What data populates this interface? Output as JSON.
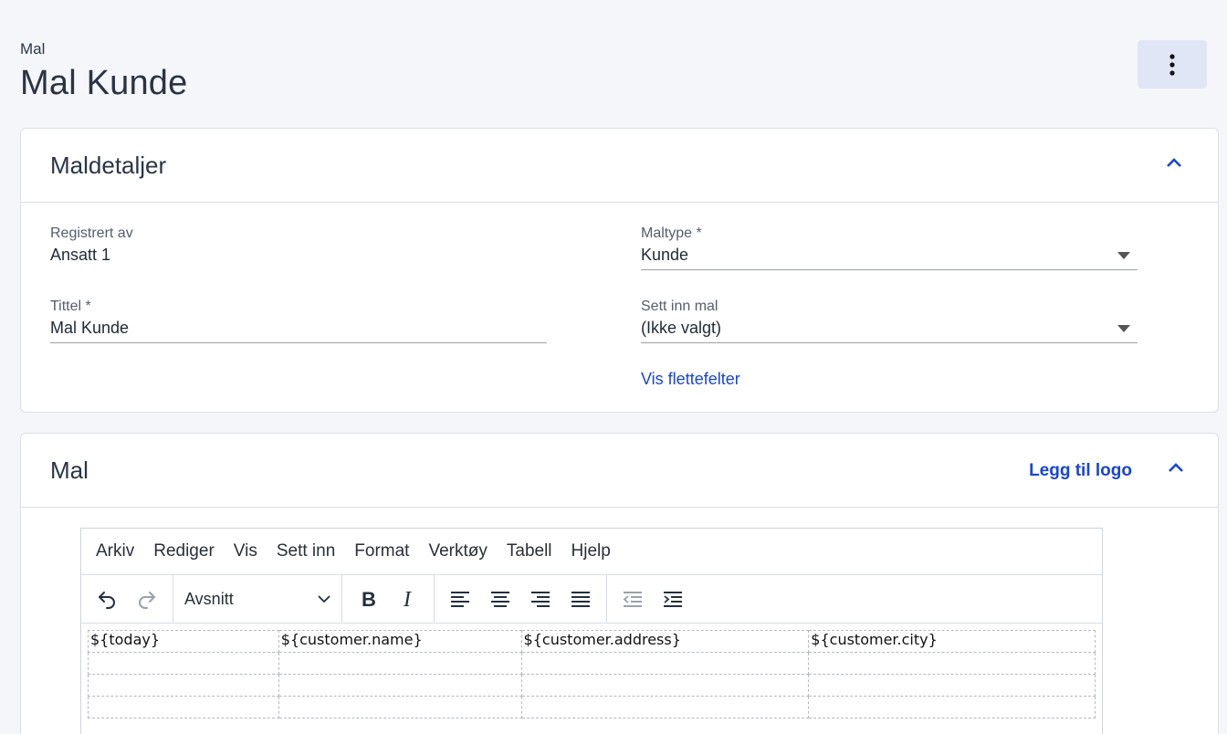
{
  "header": {
    "breadcrumb": "Mal",
    "title": "Mal Kunde",
    "more_icon": "more-vertical-icon"
  },
  "details": {
    "title": "Maldetaljer",
    "registered_by": {
      "label": "Registrert av",
      "value": "Ansatt 1"
    },
    "title_field": {
      "label": "Tittel *",
      "value": "Mal Kunde"
    },
    "template_type": {
      "label": "Maltype *",
      "value": "Kunde"
    },
    "insert_template": {
      "label": "Sett inn mal",
      "value": "(Ikke valgt)"
    },
    "merge_fields_link": "Vis flettefelter"
  },
  "template": {
    "title": "Mal",
    "add_logo_link": "Legg til logo",
    "menubar": [
      "Arkiv",
      "Rediger",
      "Vis",
      "Sett inn",
      "Format",
      "Verktøy",
      "Tabell",
      "Hjelp"
    ],
    "block_format": "Avsnitt",
    "table_rows": [
      [
        "${today}",
        "${customer.name}",
        "${customer.address}",
        "${customer.city}"
      ],
      [
        "",
        "",
        "",
        ""
      ],
      [
        "",
        "",
        "",
        ""
      ],
      [
        "",
        "",
        "",
        ""
      ]
    ]
  },
  "colors": {
    "accent": "#1a44d8",
    "background": "#f5f6fa",
    "more_button_bg": "#e1e6f7"
  }
}
